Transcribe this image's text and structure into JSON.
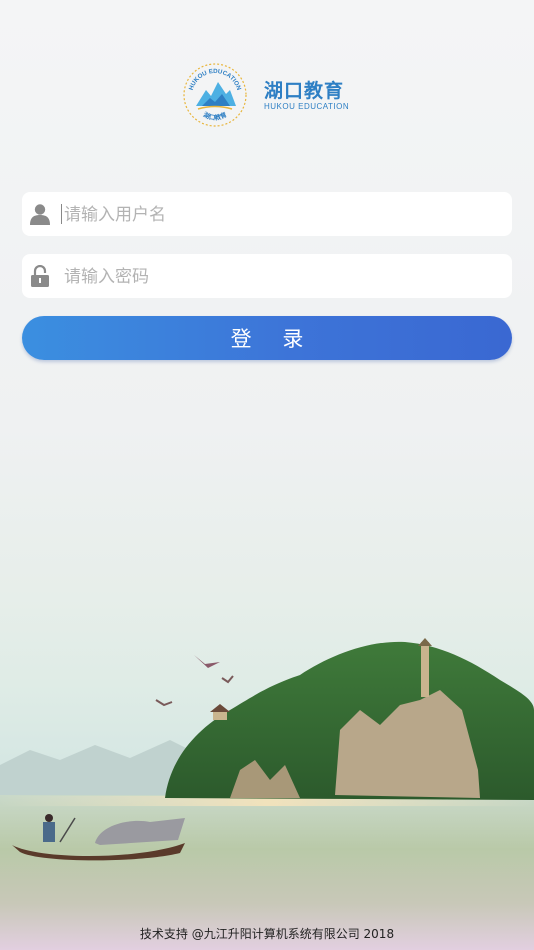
{
  "logo": {
    "title_cn": "湖口教育",
    "title_en": "HUKOU EDUCATION",
    "seal_text_en": "HUKOU EDUCATION",
    "seal_text_cn": "湖口教育"
  },
  "login_form": {
    "username_placeholder": "请输入用户名",
    "password_placeholder": "请输入密码",
    "login_button_label": "登 录"
  },
  "footer": {
    "text": "技术支持 @九江升阳计算机系统有限公司 2018"
  },
  "colors": {
    "brand_blue": "#2e7fc4",
    "button_start": "#3b8fe0",
    "button_end": "#3a68d2"
  }
}
